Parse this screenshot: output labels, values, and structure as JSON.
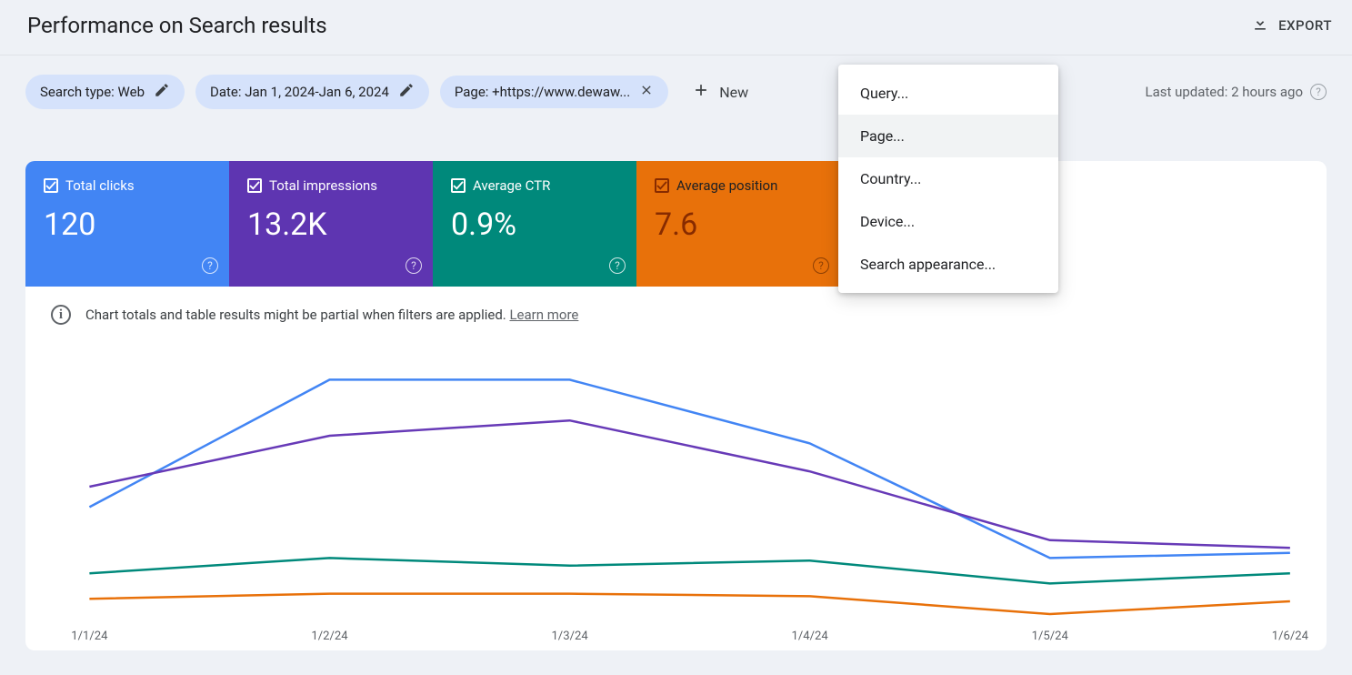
{
  "header": {
    "title": "Performance on Search results",
    "export_label": "EXPORT"
  },
  "filters": {
    "search_type": "Search type: Web",
    "date": "Date: Jan 1, 2024-Jan 6, 2024",
    "page": "Page: +https://www.dewaw...",
    "new_label": "New",
    "last_updated": "Last updated: 2 hours ago"
  },
  "dropdown": {
    "query": "Query...",
    "page": "Page...",
    "country": "Country...",
    "device": "Device...",
    "search_appearance": "Search appearance..."
  },
  "metrics": {
    "clicks_label": "Total clicks",
    "clicks_value": "120",
    "impressions_label": "Total impressions",
    "impressions_value": "13.2K",
    "ctr_label": "Average CTR",
    "ctr_value": "0.9%",
    "position_label": "Average position",
    "position_value": "7.6",
    "colors": {
      "clicks": "#4285f4",
      "impressions": "#5e35b1",
      "ctr": "#00897b",
      "position": "#e8710a"
    }
  },
  "notice": {
    "text": "Chart totals and table results might be partial when filters are applied. ",
    "learn_more": "Learn more"
  },
  "chart_data": {
    "type": "line",
    "x_labels": [
      "1/1/24",
      "1/2/24",
      "1/3/24",
      "1/4/24",
      "1/5/24",
      "1/6/24"
    ],
    "series": [
      {
        "name": "Total clicks",
        "color": "#4285f4",
        "values_rel": [
          0.42,
          0.92,
          0.92,
          0.67,
          0.22,
          0.24
        ]
      },
      {
        "name": "Total impressions",
        "color": "#673ab7",
        "values_rel": [
          0.5,
          0.7,
          0.76,
          0.56,
          0.29,
          0.26
        ]
      },
      {
        "name": "Average CTR",
        "color": "#00897b",
        "values_rel": [
          0.16,
          0.22,
          0.19,
          0.21,
          0.12,
          0.16
        ]
      },
      {
        "name": "Average position",
        "color": "#e8710a",
        "values_rel": [
          0.06,
          0.08,
          0.08,
          0.07,
          0.0,
          0.05
        ]
      }
    ]
  }
}
